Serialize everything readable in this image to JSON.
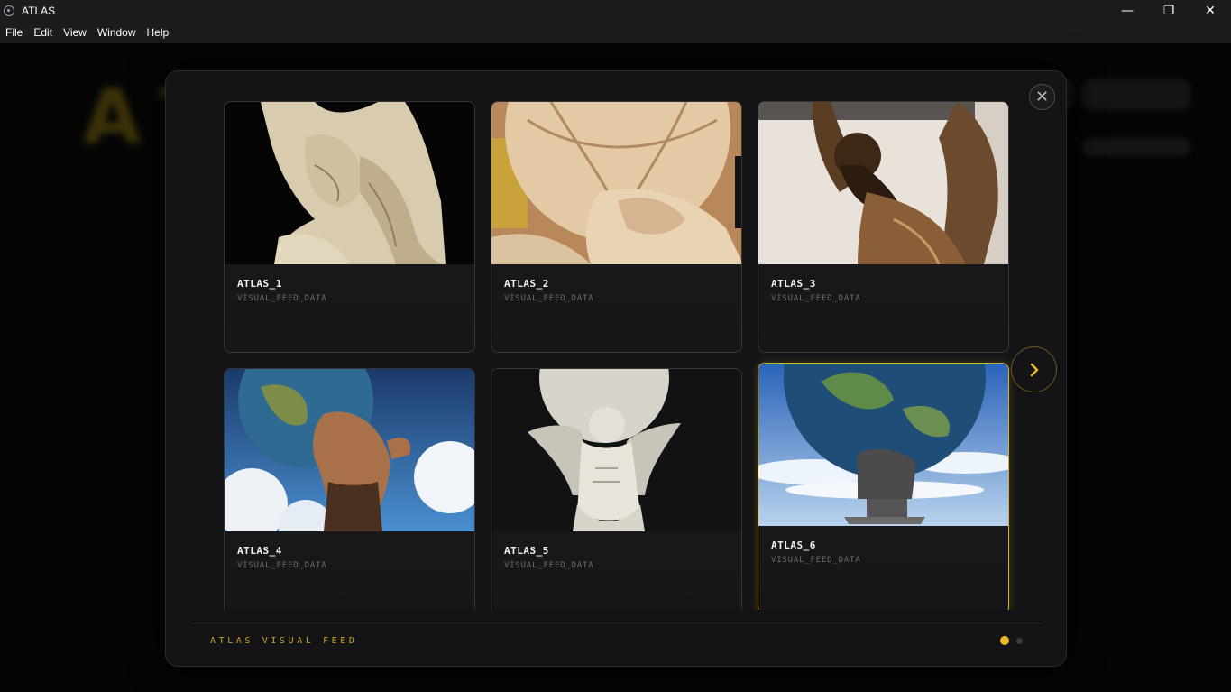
{
  "window": {
    "title": "ATLAS",
    "minimize_glyph": "—",
    "restore_glyph": "❐",
    "close_glyph": "✕"
  },
  "menu": {
    "items": [
      "File",
      "Edit",
      "View",
      "Window",
      "Help"
    ]
  },
  "background": {
    "logo_text": "ATLAS"
  },
  "modal": {
    "close_glyph": "✕",
    "cards": [
      {
        "title": "ATLAS_1",
        "subtitle": "VISUAL_FEED_DATA",
        "active": false
      },
      {
        "title": "ATLAS_2",
        "subtitle": "VISUAL_FEED_DATA",
        "active": false
      },
      {
        "title": "ATLAS_3",
        "subtitle": "VISUAL_FEED_DATA",
        "active": false
      },
      {
        "title": "ATLAS_4",
        "subtitle": "VISUAL_FEED_DATA",
        "active": false
      },
      {
        "title": "ATLAS_5",
        "subtitle": "VISUAL_FEED_DATA",
        "active": false
      },
      {
        "title": "ATLAS_6",
        "subtitle": "VISUAL_FEED_DATA",
        "active": true
      }
    ],
    "footer_label": "ATLAS VISUAL FEED",
    "pagination": {
      "current_page": 1,
      "total_pages": 2
    },
    "accent_color": "#e8b926"
  }
}
